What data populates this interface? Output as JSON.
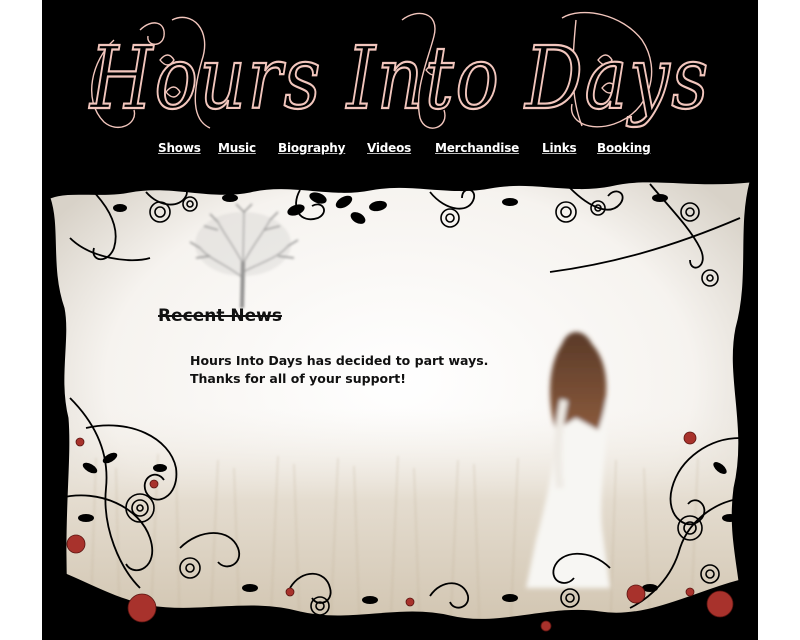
{
  "site": {
    "title": "Hours Into Days",
    "accent_color": "#f2c6bd",
    "background_color": "#000000"
  },
  "nav": {
    "items": [
      {
        "label": "Shows",
        "name": "nav-shows"
      },
      {
        "label": "Music",
        "name": "nav-music"
      },
      {
        "label": "Biography",
        "name": "nav-biography"
      },
      {
        "label": "Videos",
        "name": "nav-videos"
      },
      {
        "label": "Merchandise",
        "name": "nav-merchandise"
      },
      {
        "label": "Links",
        "name": "nav-links"
      },
      {
        "label": "Booking",
        "name": "nav-booking"
      }
    ]
  },
  "news": {
    "heading": "Recent News",
    "body": "Hours Into Days has decided to part ways. Thanks for all of your support!"
  },
  "decorations": {
    "icons": [
      "tree-icon",
      "thorn-vine-icon",
      "rose-icon",
      "girl-figure-icon",
      "wheat-field-icon"
    ]
  }
}
